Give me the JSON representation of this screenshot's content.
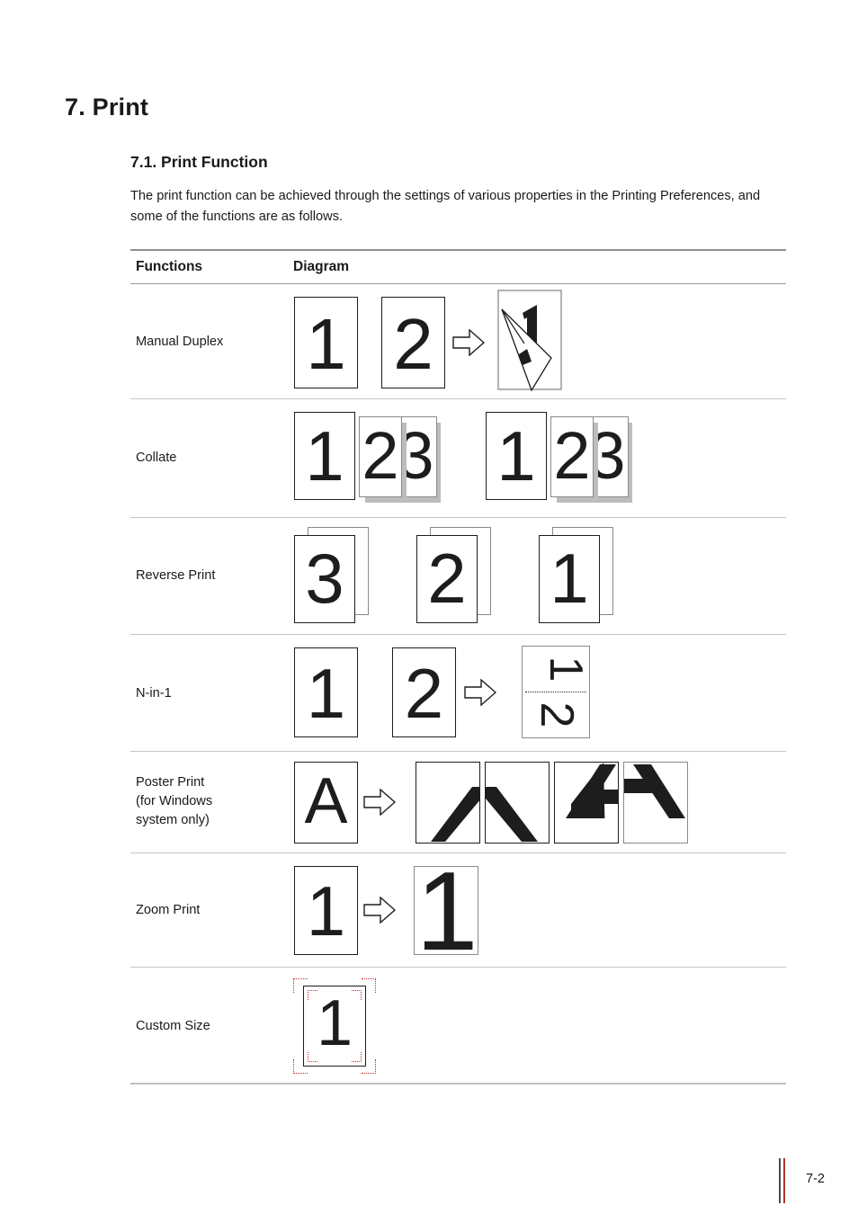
{
  "document": {
    "chapter_title": "7. Print",
    "section_title": "7.1. Print Function",
    "intro_paragraph": "The print function can be achieved through the settings of various properties in the Printing Preferences, and some of the functions are as follows.",
    "page_number": "7-2"
  },
  "table": {
    "headers": {
      "functions": "Functions",
      "diagram": "Diagram"
    },
    "rows": [
      {
        "label": "Manual Duplex",
        "diagram_type": "duplex",
        "pages": [
          "1",
          "2"
        ],
        "result_page": "1",
        "arrow": "right-arrow-icon"
      },
      {
        "label": "Collate",
        "diagram_type": "collate",
        "set_one": [
          "1",
          "2",
          "3"
        ],
        "set_two": [
          "1",
          "2",
          "3"
        ]
      },
      {
        "label": "Reverse Print",
        "diagram_type": "reverse",
        "stacks": [
          "3",
          "2",
          "1"
        ]
      },
      {
        "label": "N-in-1",
        "diagram_type": "nin1",
        "pages": [
          "1",
          "2"
        ],
        "result_page": [
          "1",
          "2"
        ],
        "arrow": "right-arrow-icon"
      },
      {
        "label": "Poster Print\n(for Windows\nsystem only)",
        "diagram_type": "poster",
        "source_page": "A",
        "tiles": 4,
        "arrow": "right-arrow-icon"
      },
      {
        "label": "Zoom Print",
        "diagram_type": "zoom",
        "source_page": "1",
        "result_page": "1",
        "arrow": "right-arrow-icon"
      },
      {
        "label": "Custom Size",
        "diagram_type": "custom",
        "page": "1",
        "crop_mark_color": "#cc2a20"
      }
    ]
  },
  "colors": {
    "text": "#1a1a1a",
    "table_top_border": "#8f8f8f",
    "row_border": "#c4c4c4",
    "sheet_border": "#1d1d1d",
    "sheet_shadow": "#bdbdbd",
    "footer_rule_dark": "#4a4a4a",
    "footer_rule_red": "#b3352b",
    "crop_mark_red": "#cc2a20"
  }
}
